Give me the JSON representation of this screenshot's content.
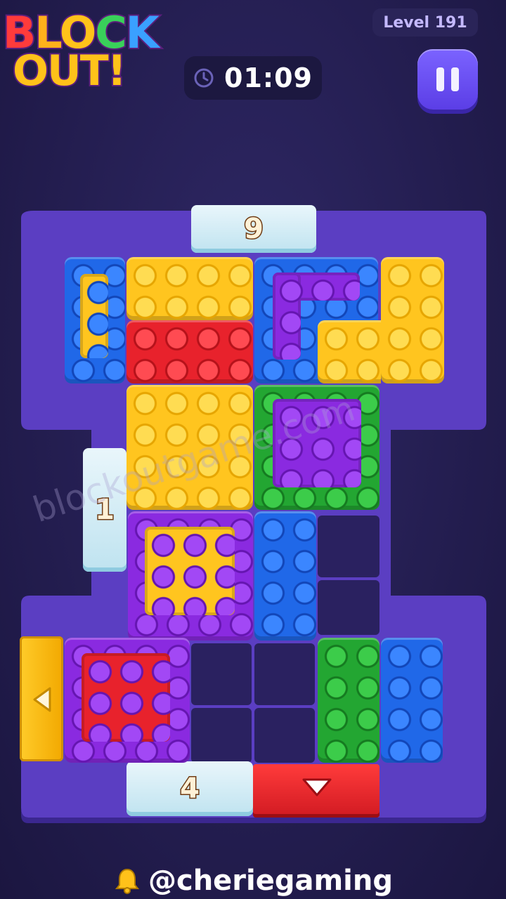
{
  "header": {
    "logo_line1": [
      "B",
      "L",
      "O",
      "C",
      "K"
    ],
    "logo_line2": "OUT!",
    "level": "Level 191",
    "timer": "01:09"
  },
  "doors": {
    "top_count": "9",
    "left_count": "1",
    "bottom_count": "4"
  },
  "watermark": "blockoutgame.com",
  "footer": {
    "handle": "@cheriegaming"
  },
  "colors": {
    "yellow": "#ffc51f",
    "red": "#e8222c",
    "blue": "#2068e8",
    "green": "#23a632",
    "purple": "#8a2ae0",
    "board": "#5b3ec2"
  }
}
